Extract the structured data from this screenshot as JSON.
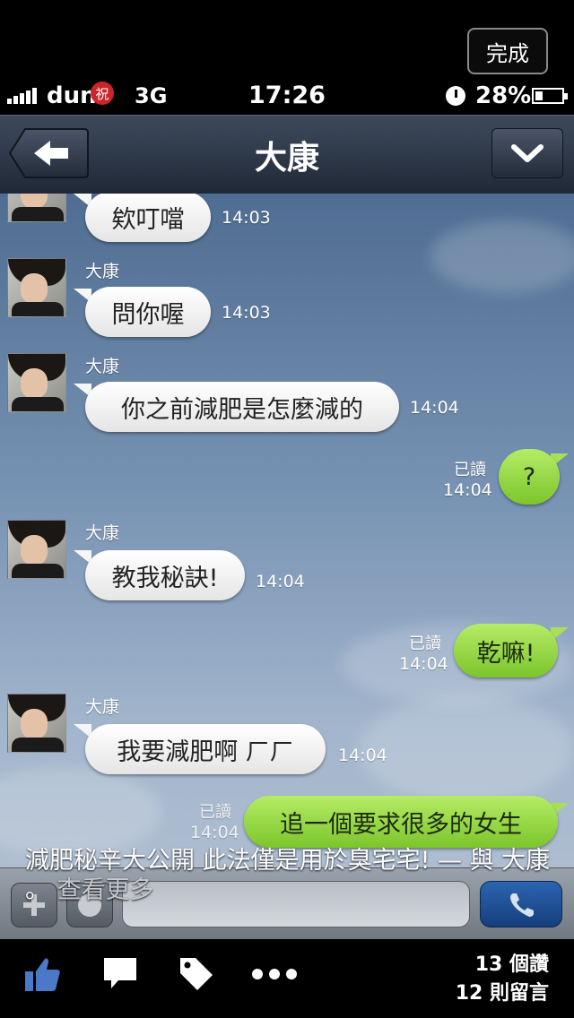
{
  "top": {
    "done_label": "完成"
  },
  "status": {
    "carrier": "dun",
    "carrier_badge": "祝",
    "network": "3G",
    "time": "17:26",
    "battery": "28%"
  },
  "nav": {
    "title": "大康"
  },
  "chat": {
    "messages": [
      {
        "sender": "",
        "text": "欸叮噹",
        "time": "14:03",
        "side": "left"
      },
      {
        "sender": "大康",
        "text": "問你喔",
        "time": "14:03",
        "side": "left"
      },
      {
        "sender": "大康",
        "text": "你之前減肥是怎麼減的",
        "time": "14:04",
        "side": "left"
      },
      {
        "read": "已讀",
        "text": "?",
        "time": "14:04",
        "side": "right"
      },
      {
        "sender": "大康",
        "text": "教我秘訣!",
        "time": "14:04",
        "side": "left"
      },
      {
        "read": "已讀",
        "text": "乾嘛!",
        "time": "14:04",
        "side": "right"
      },
      {
        "sender": "大康",
        "text": "我要減肥啊 ㄏㄏ",
        "time": "14:04",
        "side": "left"
      },
      {
        "read": "已讀",
        "text": "追一個要求很多的女生",
        "time": "14:04",
        "side": "right"
      }
    ]
  },
  "caption": {
    "text": "減肥秘辛大公開 此法僅是用於臭宅宅! — 與 大康 。",
    "more": "查看更多"
  },
  "footer": {
    "likes": "13 個讚",
    "comments": "12 則留言"
  },
  "icons": [
    "back-arrow-icon",
    "chevron-down-icon",
    "plus-icon",
    "emoji-icon",
    "phone-icon",
    "like-icon",
    "comment-icon",
    "tag-icon",
    "more-icon"
  ]
}
